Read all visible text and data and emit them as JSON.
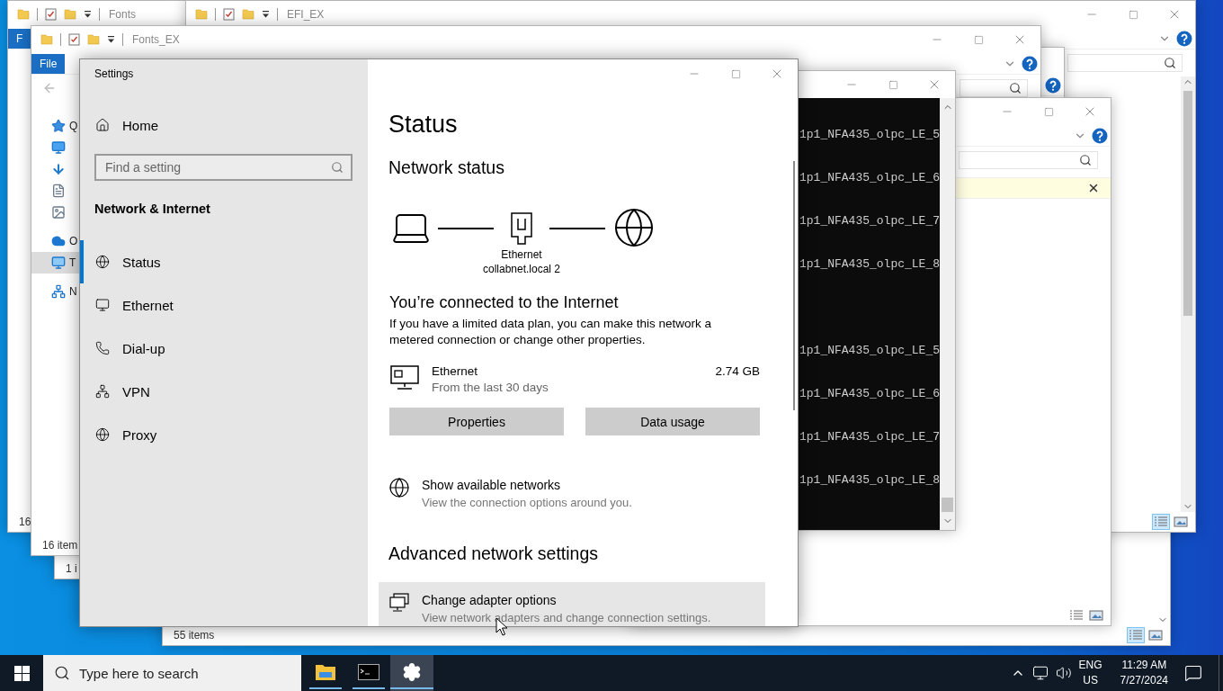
{
  "background_windows": [
    {
      "kind": "console",
      "line_groups": [
        [
          "1p1_NFA435_olpc_LE_5",
          "1p1_NFA435_olpc_LE_6",
          "1p1_NFA435_olpc_LE_7",
          "1p1_NFA435_olpc_LE_8"
        ],
        [
          "1p1_NFA435_olpc_LE_5",
          "1p1_NFA435_olpc_LE_6",
          "1p1_NFA435_olpc_LE_7",
          "1p1_NFA435_olpc_LE_8"
        ]
      ]
    },
    {
      "kind": "explorer",
      "view_buttons": [
        {
          "kind": "details",
          "selected": false
        },
        {
          "kind": "thumbnails",
          "selected": false
        }
      ]
    },
    {
      "kind": "explorer",
      "title": "Fonts_EX",
      "file_tab": "File",
      "status": "16 item",
      "nav": [
        {
          "kind": "star",
          "label": "Q",
          "selected": false
        },
        {
          "kind": "desktop",
          "selected": false
        },
        {
          "kind": "download",
          "selected": false
        },
        {
          "kind": "document",
          "selected": false
        },
        {
          "kind": "picture",
          "selected": false
        },
        {
          "kind": "cloud",
          "label": "O",
          "selected": false
        },
        {
          "kind": "pc",
          "label": "T",
          "selected": true
        },
        {
          "kind": "network",
          "label": "N",
          "selected": false
        }
      ]
    },
    {
      "kind": "explorer",
      "status": "1 i"
    },
    {
      "kind": "explorer",
      "title": "EFI_EX",
      "view_buttons": [
        {
          "kind": "details",
          "selected": true
        },
        {
          "kind": "thumbnails",
          "selected": false
        }
      ]
    },
    {
      "kind": "explorer",
      "title": "Fonts",
      "file_tab": "F",
      "status": "16"
    },
    {
      "kind": "explorer",
      "status": "55 items",
      "view_buttons": [
        {
          "kind": "details",
          "selected": true
        },
        {
          "kind": "thumbnails",
          "selected": false
        }
      ]
    }
  ],
  "settings": {
    "title": "Settings",
    "home": "Home",
    "search_placeholder": "Find a setting",
    "section": "Network & Internet",
    "nav": [
      {
        "label": "Status",
        "selected": true
      },
      {
        "label": "Ethernet",
        "selected": false
      },
      {
        "label": "Dial-up",
        "selected": false
      },
      {
        "label": "VPN",
        "selected": false
      },
      {
        "label": "Proxy",
        "selected": false
      }
    ],
    "page": {
      "title": "Status",
      "network_heading": "Network status",
      "diagram": {
        "device_label": "Ethernet",
        "network_label": "collabnet.local 2"
      },
      "connection_heading": "You’re connected to the Internet",
      "connection_text": "If you have a limited data plan, you can make this network a metered connection or change other properties.",
      "adapter": {
        "name": "Ethernet",
        "period": "From the last 30 days",
        "usage": "2.74 GB"
      },
      "buttons": [
        "Properties",
        "Data usage"
      ],
      "links": [
        {
          "title": "Show available networks",
          "subtitle": "View the connection options around you.",
          "hovered": false
        }
      ],
      "advanced_heading": "Advanced network settings",
      "advanced_links": [
        {
          "title": "Change adapter options",
          "subtitle": "View network adapters and change connection settings.",
          "hovered": true
        }
      ]
    }
  },
  "taskbar": {
    "search_placeholder": "Type here to search",
    "apps": [
      {
        "kind": "explorer",
        "active": false
      },
      {
        "kind": "console",
        "active": false
      },
      {
        "kind": "settings",
        "active": true
      }
    ],
    "language": "ENG",
    "region": "US",
    "time": "11:29 AM",
    "date": "7/27/2024"
  }
}
